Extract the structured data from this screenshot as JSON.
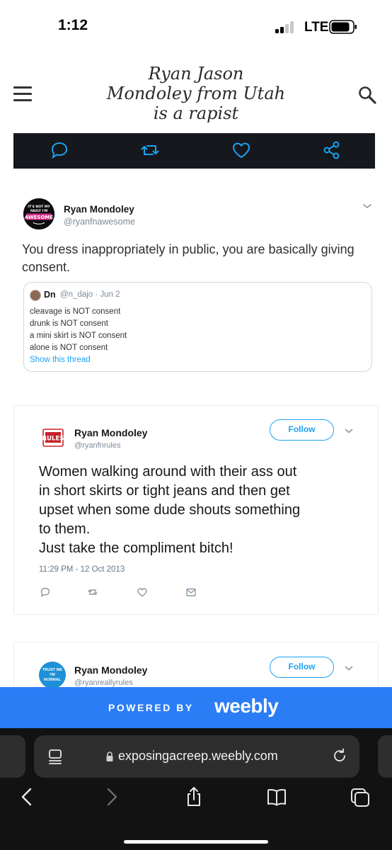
{
  "status_bar": {
    "time": "1:12",
    "network": "LTE"
  },
  "header": {
    "site_title": "Ryan Jason Mondoley from Utah is a rapist"
  },
  "tweet1": {
    "name": "Ryan Mondoley",
    "handle": "@ryanfnawesome",
    "avatar_text": "IT'S NOT MY FAULT I'M AWESOME",
    "text": "You dress inappropriately in public, you are basically giving consent.",
    "quote": {
      "name": "Dn",
      "meta": "@n_dajo · Jun 2",
      "lines": [
        "cleavage is NOT consent",
        "drunk is NOT consent",
        "a mini skirt is NOT consent",
        "alone is NOT consent"
      ],
      "show_thread": "Show this thread"
    }
  },
  "tweet2": {
    "name": "Ryan Mondoley",
    "handle": "@ryanfnrules",
    "follow": "Follow",
    "text_lines": [
      "Women walking around with their ass out",
      "in short skirts or tight jeans and then get",
      "upset when some dude shouts something",
      "to them.",
      "Just take the compliment bitch!"
    ],
    "time": "11:29 PM - 12 Oct 2013"
  },
  "tweet3": {
    "name": "Ryan Mondoley",
    "handle": "@ryanreallyrules",
    "avatar_text": "TRUST ME I'M NORMAL",
    "follow": "Follow"
  },
  "weebly_banner": {
    "powered_by": "POWERED BY",
    "brand": "weebly"
  },
  "browser": {
    "url": "exposingacreep.weebly.com"
  },
  "colors": {
    "twitter_blue": "#1da1f2",
    "weebly_blue": "#2b7df6",
    "safari_bg": "#121212"
  },
  "icons": [
    "hamburger-icon",
    "search-icon",
    "reply-icon",
    "retweet-icon",
    "like-icon",
    "share-icon",
    "dm-icon",
    "lock-icon",
    "reload-icon",
    "back-icon",
    "forward-icon",
    "share-icon",
    "bookmarks-icon",
    "tabs-icon"
  ]
}
